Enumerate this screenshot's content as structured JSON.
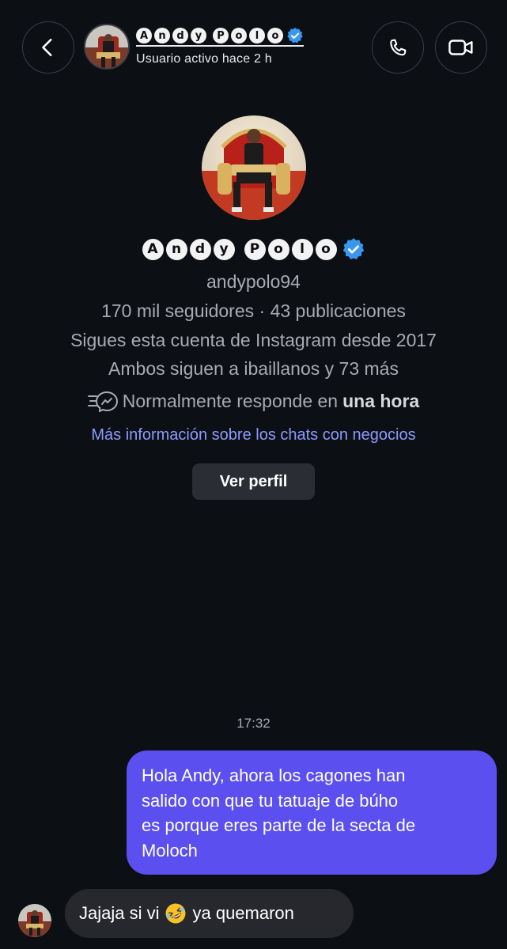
{
  "header": {
    "name_letters_1": [
      "A",
      "n",
      "d",
      "y"
    ],
    "name_letters_2": [
      "P",
      "o",
      "l",
      "o"
    ],
    "status": "Usuario activo hace 2 h",
    "back_icon": "chevron-left-icon",
    "call_icon": "phone-icon",
    "video_icon": "video-camera-icon"
  },
  "profile": {
    "name_letters_1": [
      "A",
      "n",
      "d",
      "y"
    ],
    "name_letters_2": [
      "P",
      "o",
      "l",
      "o"
    ],
    "handle": "andypolo94",
    "stats": "170 mil seguidores · 43 publicaciones",
    "follow_since": "Sigues esta cuenta de Instagram desde 2017",
    "mutual": "Ambos siguen a ibaillanos y 73 más",
    "response_prefix": "Normalmente responde en",
    "response_bold": "una hora",
    "info_link": "Más información sobre los chats con negocios",
    "view_profile": "Ver perfil"
  },
  "chat": {
    "timestamp": "17:32",
    "sent_lines": [
      "Hola Andy, ahora los cagones han",
      "salido con que tu tatuaje de búho",
      "es porque eres parte de la secta de",
      "Moloch"
    ],
    "received_before_emoji": "Jajaja si vi",
    "received_emoji": "rolling-on-floor-laughing-emoji",
    "received_after_emoji": "ya quemaron"
  },
  "colors": {
    "background": "#0c0f14",
    "sent_bubble": "#5b4ff0",
    "received_bubble": "#26282e",
    "link": "#8e9bff",
    "verified": "#3897f0"
  }
}
